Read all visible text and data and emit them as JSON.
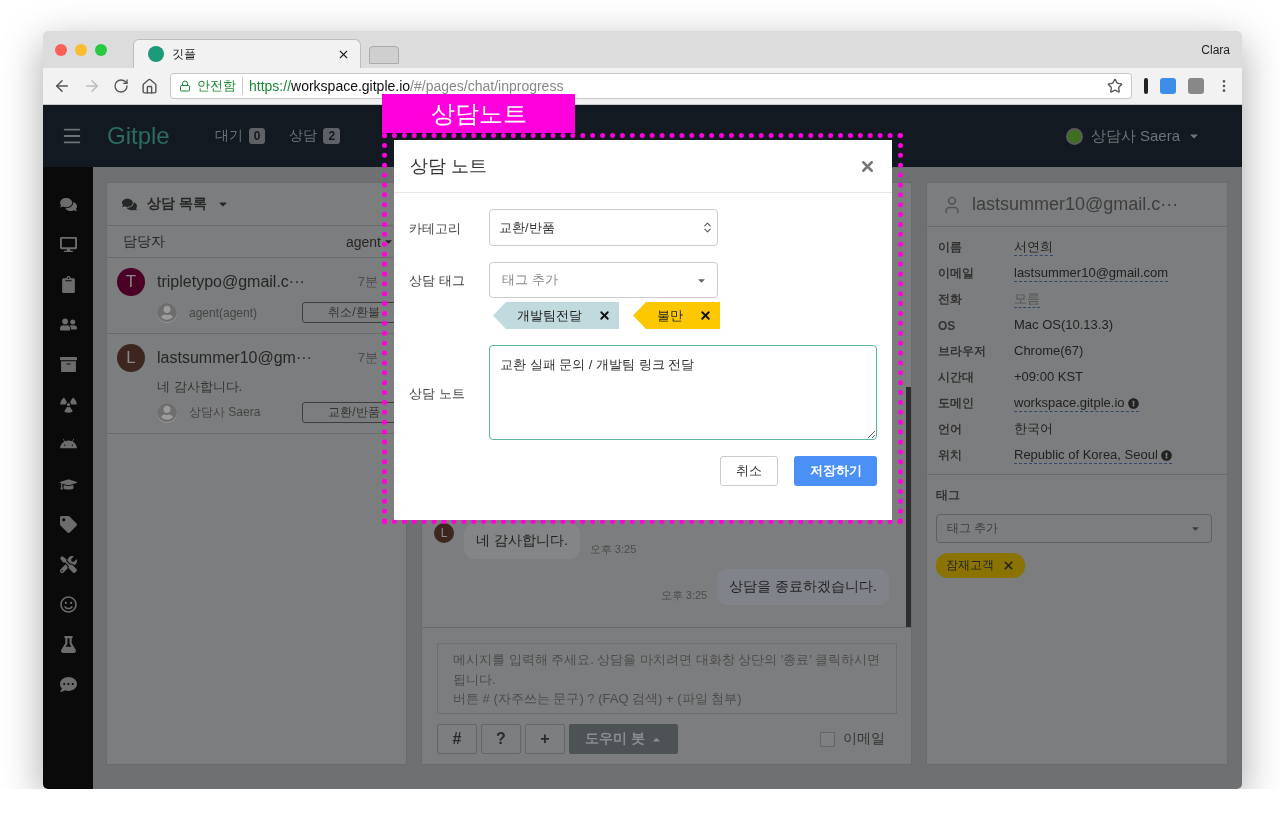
{
  "browser": {
    "tab_title": "깃플",
    "profile": "Clara",
    "security": "안전함",
    "url_scheme": "https://",
    "url_host": "workspace.gitple.io",
    "url_path": "/#/pages/chat/inprogress"
  },
  "annotation": {
    "label": "상담노트"
  },
  "navbar": {
    "logo": "Gitple",
    "menu": [
      {
        "label": "대기",
        "count": "0"
      },
      {
        "label": "상담",
        "count": "2"
      }
    ],
    "agent": "상담사 Saera"
  },
  "consult_list": {
    "title": "상담 목록",
    "filter_label": "담당자",
    "filter_value": "agent",
    "items": [
      {
        "initial": "T",
        "color": "#4b0026",
        "name": "tripletypo@gmail.c···",
        "time": "7분",
        "agent": "agent(agent)",
        "category": "취소/환불"
      },
      {
        "initial": "L",
        "color": "#3d2620",
        "name": "lastsummer10@gm···",
        "time": "7분",
        "message": "네 감사합니다.",
        "agent": "상담사 Saera",
        "category": "교환/반품"
      }
    ]
  },
  "chat": {
    "messages": [
      {
        "kind": "customer",
        "initial": "L",
        "text": "네 감사합니다.",
        "time": "오후 3:25"
      },
      {
        "kind": "agent",
        "text": "상담을 종료하겠습니다.",
        "time": "오후 3:25"
      }
    ],
    "placeholder": "메시지를 입력해 주세요. 상담을 마치려면 대화창 상단의 '종료' 클릭하시면 됩니다.\n버튼 # (자주쓰는 문구) ? (FAQ 검색) + (파일 첨부)",
    "tools": [
      "#",
      "?",
      "+"
    ],
    "bot_button": "도우미 봇",
    "email": {
      "label": "이메일",
      "checked": false
    }
  },
  "customer": {
    "title": "lastsummer10@gmail.c···",
    "fields": [
      {
        "label": "이름",
        "value": "서연희",
        "kind": "editable",
        "info": false,
        "muted": false
      },
      {
        "label": "이메일",
        "value": "lastsummer10@gmail.com",
        "kind": "editable",
        "info": false,
        "muted": false
      },
      {
        "label": "전화",
        "value": "모름",
        "kind": "editable",
        "info": false,
        "muted": true
      },
      {
        "label": "OS",
        "value": "Mac OS(10.13.3)",
        "kind": "plain",
        "info": false,
        "muted": false
      },
      {
        "label": "브라우저",
        "value": "Chrome(67)",
        "kind": "plain",
        "info": false,
        "muted": false
      },
      {
        "label": "시간대",
        "value": "+09:00 KST",
        "kind": "plain",
        "info": false,
        "muted": false
      },
      {
        "label": "도메인",
        "value": "workspace.gitple.io",
        "kind": "editable",
        "info": true,
        "muted": false
      },
      {
        "label": "언어",
        "value": "한국어",
        "kind": "plain",
        "info": false,
        "muted": false
      },
      {
        "label": "위치",
        "value": "Republic of Korea, Seoul",
        "kind": "editable",
        "info": true,
        "muted": false
      }
    ],
    "tags": {
      "label": "태그",
      "placeholder": "태그 추가",
      "items": [
        "잠재고객"
      ]
    }
  },
  "modal": {
    "title": "상담 노트",
    "category": {
      "label": "카테고리",
      "value": "교환/반품"
    },
    "tag": {
      "label": "상담 태그",
      "placeholder": "태그 추가",
      "items": [
        {
          "label": "개발팀전달",
          "color": "#c1dade"
        },
        {
          "label": "불만",
          "color": "#fdc800"
        }
      ]
    },
    "note": {
      "label": "상담 노트",
      "value": "교환 실패 문의 / 개발팀 링크 전달"
    },
    "cancel": "취소",
    "save": "저장하기"
  }
}
